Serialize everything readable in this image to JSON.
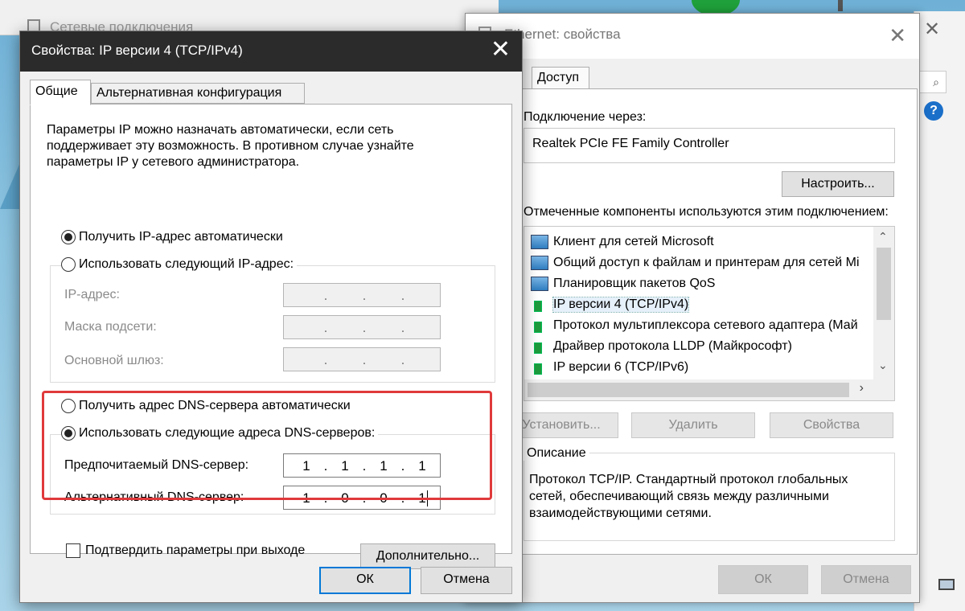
{
  "background": {
    "window_title": "Сетевые подключения"
  },
  "ethernet_window": {
    "title": "Ethernet: свойства",
    "tab_access": "Доступ",
    "connect_via_label": "Подключение через:",
    "adapter": "Realtek PCIe FE Family Controller",
    "configure_button": "Настроить...",
    "components_label": "Отмеченные компоненты используются этим подключением:",
    "components": [
      {
        "label": "Клиент для сетей Microsoft",
        "icon": "network-client-icon"
      },
      {
        "label": "Общий доступ к файлам и принтерам для сетей Mi",
        "icon": "network-service-icon"
      },
      {
        "label": "Планировщик пакетов QoS",
        "icon": "network-service-icon"
      },
      {
        "label": "IP версии 4 (TCP/IPv4)",
        "icon": "protocol-icon",
        "selected": true
      },
      {
        "label": "Протокол мультиплексора сетевого адаптера (Май",
        "icon": "protocol-icon"
      },
      {
        "label": "Драйвер протокола LLDP (Майкрософт)",
        "icon": "protocol-icon"
      },
      {
        "label": "IP версии 6 (TCP/IPv6)",
        "icon": "protocol-icon"
      }
    ],
    "install_button": "Установить...",
    "remove_button": "Удалить",
    "properties_button": "Свойства",
    "description_label": "Описание",
    "description_text": "Протокол TCP/IP. Стандартный протокол глобальных сетей, обеспечивающий связь между различными взаимодействующими сетями.",
    "ok_button": "ОК",
    "cancel_button": "Отмена"
  },
  "ipv4_window": {
    "title": "Свойства: IP версии 4 (TCP/IPv4)",
    "tabs": [
      "Общие",
      "Альтернативная конфигурация"
    ],
    "intro": "Параметры IP можно назначать автоматически, если сеть поддерживает эту возможность. В противном случае узнайте параметры IP у сетевого администратора.",
    "radio_ip_auto": "Получить IP-адрес автоматически",
    "radio_ip_manual": "Использовать следующий IP-адрес:",
    "ip_label": "IP-адрес:",
    "mask_label": "Маска подсети:",
    "gateway_label": "Основной шлюз:",
    "radio_dns_auto": "Получить адрес DNS-сервера автоматически",
    "radio_dns_manual": "Использовать следующие адреса DNS-серверов:",
    "preferred_dns_label": "Предпочитаемый DNS-сервер:",
    "preferred_dns": [
      "1",
      "1",
      "1",
      "1"
    ],
    "alternate_dns_label": "Альтернативный DNS-сервер:",
    "alternate_dns": [
      "1",
      "0",
      "0",
      "1"
    ],
    "confirm_checkbox": "Подтвердить параметры при выходе",
    "advanced_button": "Дополнительно...",
    "ok_button": "ОК",
    "cancel_button": "Отмена",
    "highlight_color": "#e0393b"
  }
}
